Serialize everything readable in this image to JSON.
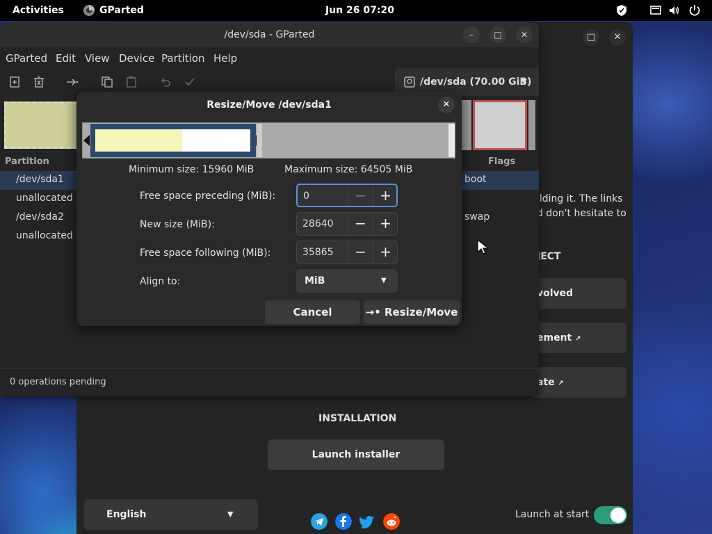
{
  "topbar": {
    "activities": "Activities",
    "app_name": "GParted",
    "datetime": "Jun 26  07:20",
    "icons": [
      "shield-icon",
      "display-icon",
      "volume-icon",
      "power-icon"
    ]
  },
  "welcome": {
    "text_line1": "ilding it. The links",
    "text_line2": "d don't hesitate to",
    "section_project": "JECT",
    "card1": "volved",
    "card2": "ement",
    "card3": "ate",
    "section_installation": "INSTALLATION",
    "launch_installer": "Launch installer",
    "language": "English",
    "launch_at_start": "Launch at start"
  },
  "gparted": {
    "title": "/dev/sda - GParted",
    "menu": [
      "GParted",
      "Edit",
      "View",
      "Device",
      "Partition",
      "Help"
    ],
    "device": "/dev/sda (70.00 GiB)",
    "columns": {
      "partition": "Partition",
      "flags": "Flags"
    },
    "rows": [
      {
        "name": "/dev/sda1",
        "flags": "boot"
      },
      {
        "name": "unallocated",
        "flags": ""
      },
      {
        "name": "/dev/sda2",
        "flags": "swap"
      },
      {
        "name": "unallocated",
        "flags": ""
      }
    ],
    "status": "0 operations pending"
  },
  "dialog": {
    "title": "Resize/Move /dev/sda1",
    "min_size": "Minimum size: 15960 MiB",
    "max_size": "Maximum size: 64505 MiB",
    "free_preceding_label": "Free space preceding (MiB):",
    "free_preceding_value": "0",
    "new_size_label": "New size (MiB):",
    "new_size_value": "28640",
    "free_following_label": "Free space following (MiB):",
    "free_following_value": "35865",
    "align_label": "Align to:",
    "align_value": "MiB",
    "cancel": "Cancel",
    "resize_move": "Resize/Move"
  },
  "colors": {
    "accent": "#5b8fd8",
    "toggle_on": "#2b9d7b",
    "partition_used": "#f6f6b8",
    "partition_border": "#2b4a6e"
  }
}
